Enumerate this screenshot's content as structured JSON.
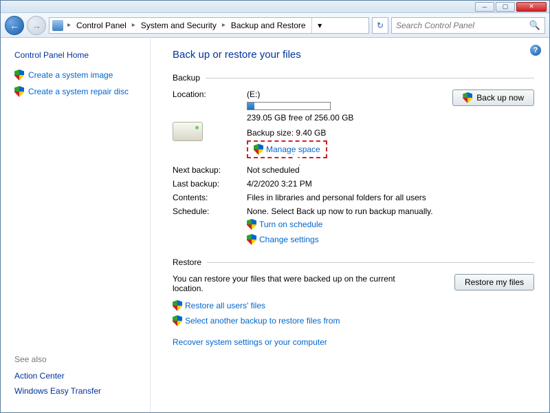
{
  "breadcrumb": {
    "items": [
      "Control Panel",
      "System and Security",
      "Backup and Restore"
    ]
  },
  "search": {
    "placeholder": "Search Control Panel"
  },
  "sidebar": {
    "heading": "Control Panel Home",
    "links": [
      "Create a system image",
      "Create a system repair disc"
    ],
    "seealso_label": "See also",
    "seealso": [
      "Action Center",
      "Windows Easy Transfer"
    ]
  },
  "main": {
    "title": "Back up or restore your files",
    "backup_section": "Backup",
    "restore_section": "Restore",
    "location_label": "Location:",
    "location_value": "(E:)",
    "free_text": "239.05 GB free of 256.00 GB",
    "backup_size": "Backup size: 9.40 GB",
    "manage_space": "Manage space",
    "backup_now": "Back up now",
    "next_backup_label": "Next backup:",
    "next_backup_value": "Not scheduled",
    "last_backup_label": "Last backup:",
    "last_backup_value": "4/2/2020 3:21 PM",
    "contents_label": "Contents:",
    "contents_value": "Files in libraries and personal folders for all users",
    "schedule_label": "Schedule:",
    "schedule_value": "None. Select Back up now to run backup manually.",
    "turn_on_schedule": "Turn on schedule",
    "change_settings": "Change settings",
    "restore_text": "You can restore your files that were backed up on the current location.",
    "restore_my_files": "Restore my files",
    "restore_all_users": "Restore all users' files",
    "select_another": "Select another backup to restore files from",
    "recover_system": "Recover system settings or your computer"
  }
}
